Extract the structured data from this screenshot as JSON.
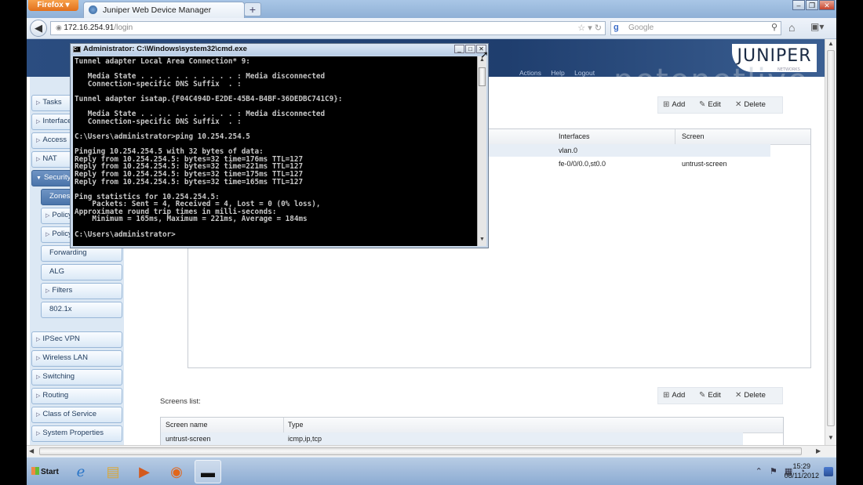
{
  "browser": {
    "app_button": "Firefox",
    "tab_title": "Juniper Web Device Manager",
    "new_tab": "+",
    "url_host": "172.16.254.91",
    "url_path": "/login",
    "search_engine": "g",
    "search_placeholder": "Google"
  },
  "app": {
    "logo": "JUNIPER",
    "logo_sub": "NETWORKS",
    "menu": [
      "Actions",
      "Help",
      "Logout"
    ],
    "watermark": "petenetlive"
  },
  "sidebar": {
    "items": [
      {
        "label": "Tasks",
        "arrow": "▷"
      },
      {
        "label": "Interface",
        "arrow": "▷"
      },
      {
        "label": "Access",
        "arrow": "▷"
      },
      {
        "label": "NAT",
        "arrow": "▷"
      },
      {
        "label": "Security",
        "arrow": "▼"
      },
      {
        "label": "Zones",
        "arrow": ""
      },
      {
        "label": "Policy",
        "arrow": "▷"
      },
      {
        "label": "Policy",
        "arrow": "▷"
      },
      {
        "label": "Forwarding",
        "arrow": ""
      },
      {
        "label": "ALG",
        "arrow": ""
      },
      {
        "label": "Filters",
        "arrow": "▷"
      },
      {
        "label": "802.1x",
        "arrow": ""
      },
      {
        "label": "IPSec VPN",
        "arrow": "▷"
      },
      {
        "label": "Wireless LAN",
        "arrow": "▷"
      },
      {
        "label": "Switching",
        "arrow": "▷"
      },
      {
        "label": "Routing",
        "arrow": "▷"
      },
      {
        "label": "Class of Service",
        "arrow": "▷"
      },
      {
        "label": "System Properties",
        "arrow": "▷"
      }
    ]
  },
  "toolbar": {
    "add": "Add",
    "edit": "Edit",
    "delete": "Delete"
  },
  "zones_grid": {
    "headers": {
      "interfaces": "Interfaces",
      "screen": "Screen"
    },
    "rows": [
      {
        "interfaces": "vlan.0",
        "screen": ""
      },
      {
        "interfaces": "fe-0/0/0.0,st0.0",
        "screen": "untrust-screen"
      }
    ]
  },
  "screens": {
    "label": "Screens list:",
    "headers": {
      "name": "Screen name",
      "type": "Type"
    },
    "rows": [
      {
        "name": "untrust-screen",
        "type": "icmp,ip,tcp"
      }
    ]
  },
  "cmd": {
    "title": "Administrator: C:\\Windows\\system32\\cmd.exe",
    "lines": [
      "Tunnel adapter Local Area Connection* 9:",
      "",
      "   Media State . . . . . . . . . . . : Media disconnected",
      "   Connection-specific DNS Suffix  . :",
      "",
      "Tunnel adapter isatap.{F04C494D-E2DE-45B4-B4BF-36DEDBC741C9}:",
      "",
      "   Media State . . . . . . . . . . . : Media disconnected",
      "   Connection-specific DNS Suffix  . :",
      "",
      "C:\\Users\\administrator>ping 10.254.254.5",
      "",
      "Pinging 10.254.254.5 with 32 bytes of data:",
      "Reply from 10.254.254.5: bytes=32 time=176ms TTL=127",
      "Reply from 10.254.254.5: bytes=32 time=221ms TTL=127",
      "Reply from 10.254.254.5: bytes=32 time=175ms TTL=127",
      "Reply from 10.254.254.5: bytes=32 time=165ms TTL=127",
      "",
      "Ping statistics for 10.254.254.5:",
      "    Packets: Sent = 4, Received = 4, Lost = 0 (0% loss),",
      "Approximate round trip times in milli-seconds:",
      "    Minimum = 165ms, Maximum = 221ms, Average = 184ms",
      "",
      "C:\\Users\\administrator>"
    ]
  },
  "taskbar": {
    "start": "Start",
    "time": "15:29",
    "date": "08/11/2012"
  }
}
